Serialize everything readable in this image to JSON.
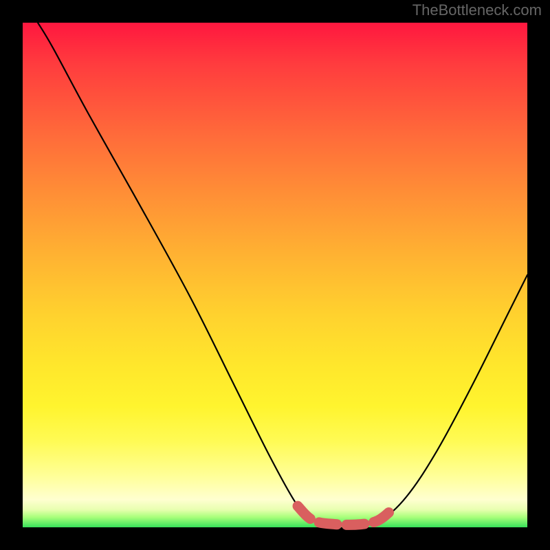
{
  "watermark": "TheBottleneck.com",
  "chart_data": {
    "type": "line",
    "title": "",
    "xlabel": "",
    "ylabel": "",
    "xlim": [
      0,
      100
    ],
    "ylim": [
      0,
      100
    ],
    "series": [
      {
        "name": "bottleneck-curve",
        "points": [
          {
            "x": 3,
            "y": 100
          },
          {
            "x": 6,
            "y": 95
          },
          {
            "x": 13,
            "y": 82
          },
          {
            "x": 22,
            "y": 66
          },
          {
            "x": 33,
            "y": 46
          },
          {
            "x": 42,
            "y": 28
          },
          {
            "x": 49,
            "y": 14
          },
          {
            "x": 54,
            "y": 5
          },
          {
            "x": 57,
            "y": 1.5
          },
          {
            "x": 62,
            "y": 0.7
          },
          {
            "x": 67,
            "y": 0.7
          },
          {
            "x": 71,
            "y": 1.5
          },
          {
            "x": 76,
            "y": 6
          },
          {
            "x": 82,
            "y": 15
          },
          {
            "x": 89,
            "y": 28
          },
          {
            "x": 96,
            "y": 42
          },
          {
            "x": 100,
            "y": 50
          }
        ]
      },
      {
        "name": "bottom-highlight",
        "points": [
          {
            "x": 54.5,
            "y": 4.2
          },
          {
            "x": 57.5,
            "y": 1.4
          },
          {
            "x": 62.0,
            "y": 0.6
          },
          {
            "x": 67.0,
            "y": 0.6
          },
          {
            "x": 70.5,
            "y": 1.4
          },
          {
            "x": 73.5,
            "y": 3.8
          }
        ]
      }
    ],
    "highlight_color": "#d95f5f",
    "curve_color": "#000000"
  }
}
